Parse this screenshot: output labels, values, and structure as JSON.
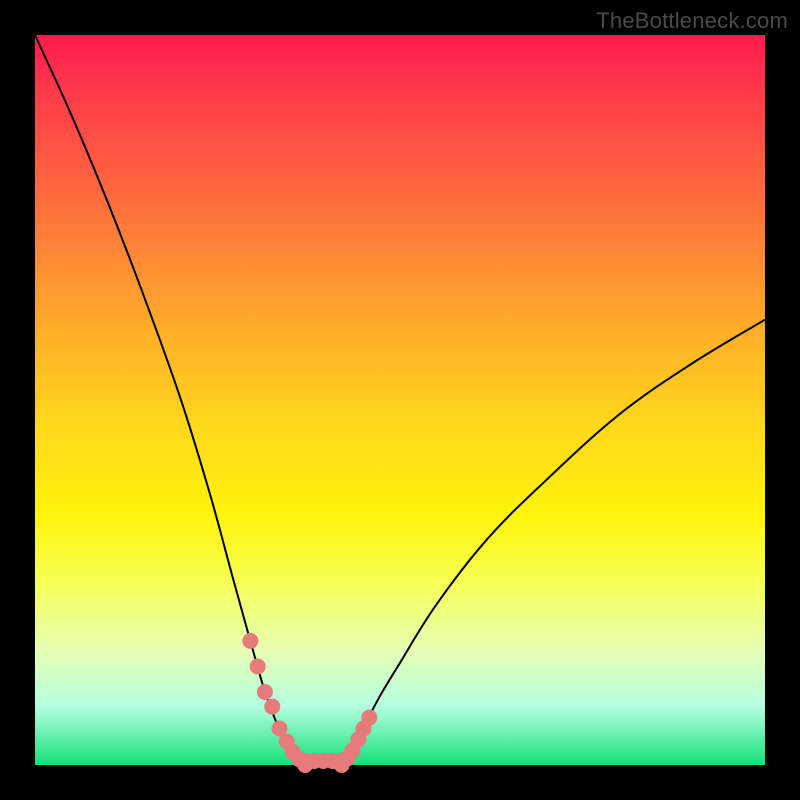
{
  "watermark": "TheBottleneck.com",
  "chart_data": {
    "type": "line",
    "title": "",
    "xlabel": "",
    "ylabel": "",
    "ylim": [
      0,
      100
    ],
    "series": [
      {
        "name": "left-curve",
        "x": [
          0,
          5,
          10,
          15,
          20,
          24,
          27,
          29.5,
          31.5,
          33,
          34,
          35,
          36,
          37
        ],
        "values": [
          100,
          89,
          77,
          64,
          50,
          37,
          26,
          17,
          10,
          6,
          3.5,
          1.8,
          0.7,
          0
        ]
      },
      {
        "name": "right-curve",
        "x": [
          42,
          43,
          44,
          45,
          47,
          50,
          55,
          62,
          70,
          80,
          90,
          100
        ],
        "values": [
          0,
          1.2,
          3,
          5,
          9,
          14,
          22,
          31,
          39,
          48,
          55,
          61
        ]
      }
    ],
    "highlight_points": {
      "left": {
        "x": [
          29.5,
          30.5,
          31.5,
          32.5,
          33.5,
          34.5,
          35.3,
          36.2,
          37
        ],
        "values": [
          17,
          13.5,
          10,
          8,
          5,
          3.2,
          1.8,
          0.8,
          0
        ]
      },
      "right": {
        "x": [
          42,
          42.8,
          43.5,
          44.3,
          45,
          45.8
        ],
        "values": [
          0,
          0.9,
          2,
          3.5,
          5,
          6.5
        ]
      },
      "floor": {
        "x": [
          37,
          38.25,
          39.5,
          40.75,
          42
        ]
      }
    },
    "colors": {
      "curve": "#000000",
      "dot": "#e77a7a",
      "floor": "#14e07a"
    }
  }
}
